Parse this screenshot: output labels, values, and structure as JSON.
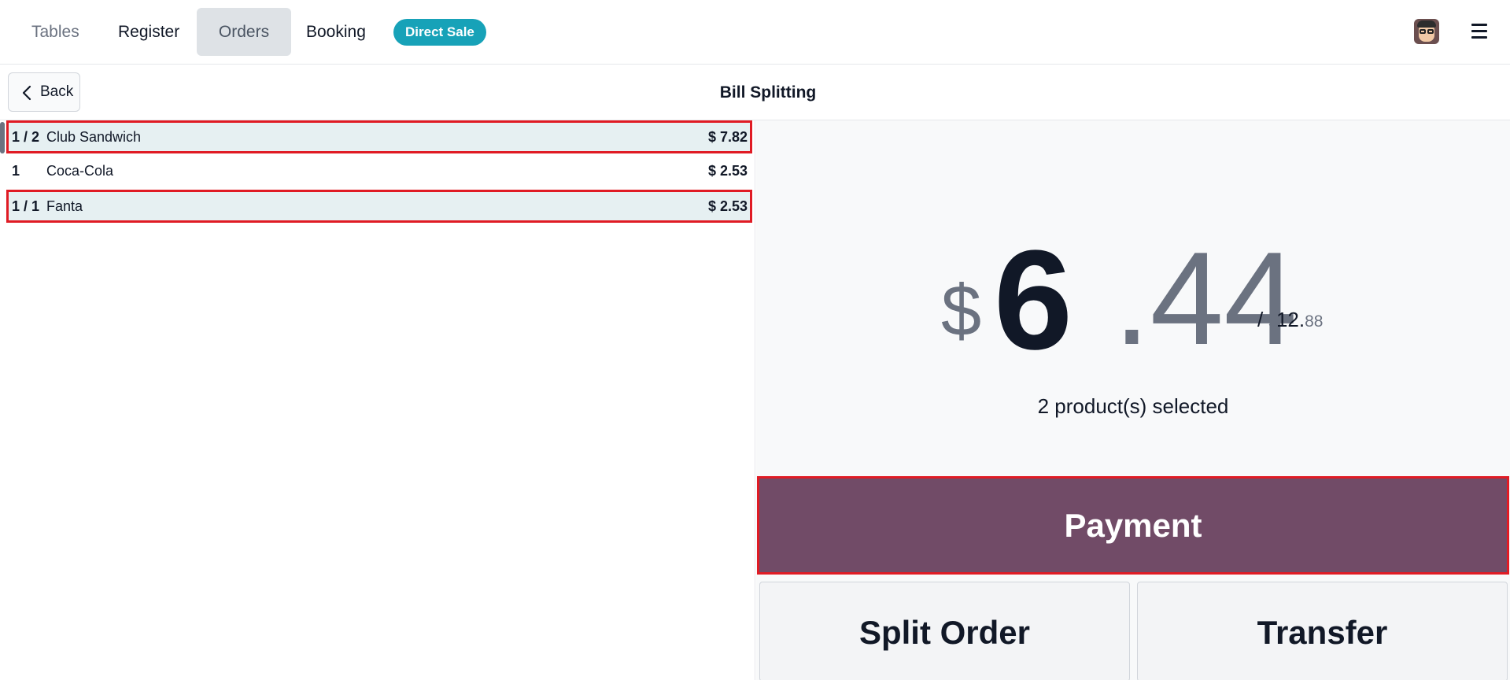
{
  "nav": {
    "tables": "Tables",
    "register": "Register",
    "orders": "Orders",
    "booking": "Booking",
    "direct_sale": "Direct Sale"
  },
  "icons": {
    "avatar": "user-avatar",
    "menu": "hamburger-menu-icon",
    "back": "chevron-left-icon"
  },
  "subheader": {
    "back_label": "Back",
    "title": "Bill Splitting"
  },
  "order_lines": [
    {
      "qty": "1 / 2",
      "name": "Club Sandwich",
      "price": "$ 7.82",
      "selected": true
    },
    {
      "qty": "1",
      "name": "Coca-Cola",
      "price": "$ 2.53",
      "selected": false
    },
    {
      "qty": "1 / 1",
      "name": "Fanta",
      "price": "$ 2.53",
      "selected": true
    }
  ],
  "summary": {
    "currency": "$",
    "amount_int": "6",
    "amount_dec": ".44",
    "total_prefix": "/",
    "total_currency": "$",
    "total_int": "12.",
    "total_dec": "88",
    "selected_text": "2 product(s) selected"
  },
  "actions": {
    "payment": "Payment",
    "split_order": "Split Order",
    "transfer": "Transfer"
  },
  "colors": {
    "payment_bg": "#714b67",
    "direct_sale_badge": "#17a2b8",
    "highlight_border": "#e01b24",
    "selected_row_bg": "#e6f0f2"
  }
}
